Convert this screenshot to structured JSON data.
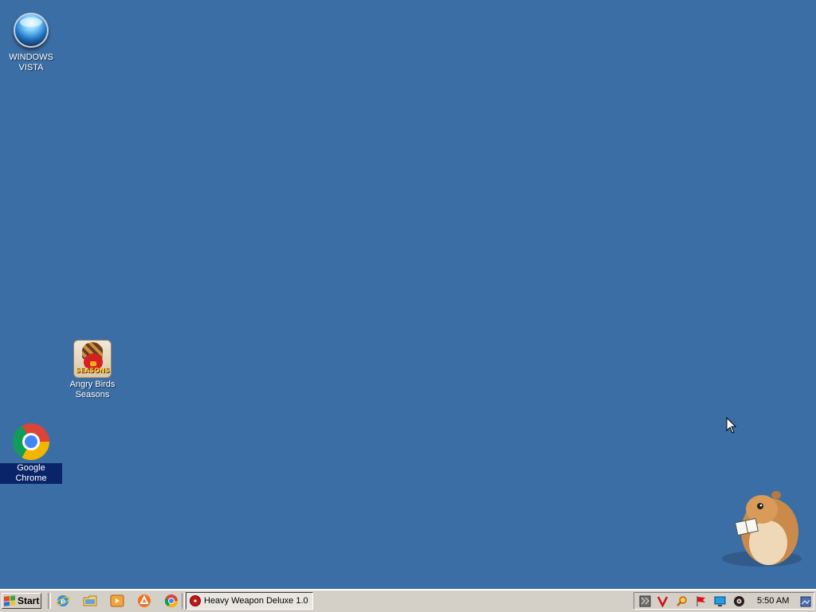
{
  "desktop": {
    "icons": [
      {
        "label_line1": "WINDOWS",
        "label_line2": "VISTA",
        "icon": "windows-vista-orb-icon"
      },
      {
        "label_line1": "Angry Birds",
        "label_line2": "Seasons",
        "icon": "angry-birds-seasons-icon",
        "tile_text": "SEASONS"
      },
      {
        "label": "Google Chrome",
        "icon": "google-chrome-icon",
        "selected": true
      }
    ],
    "background_color": "#3b6ea5"
  },
  "taskbar": {
    "start_label": "Start",
    "quick_launch": [
      "internet-explorer-icon",
      "folder-icon",
      "media-player-icon",
      "avast-icon",
      "chrome-icon"
    ],
    "tasks": [
      {
        "label": "Heavy Weapon Deluxe 1.0",
        "icon": "heavy-weapon-icon",
        "active": true
      }
    ],
    "tray": {
      "icons": [
        "tray-monitor-icon",
        "tray-v-icon",
        "tray-search-icon",
        "tray-flag-icon",
        "tray-network-icon",
        "tray-audio-icon"
      ],
      "clock": "5:50 AM"
    }
  }
}
